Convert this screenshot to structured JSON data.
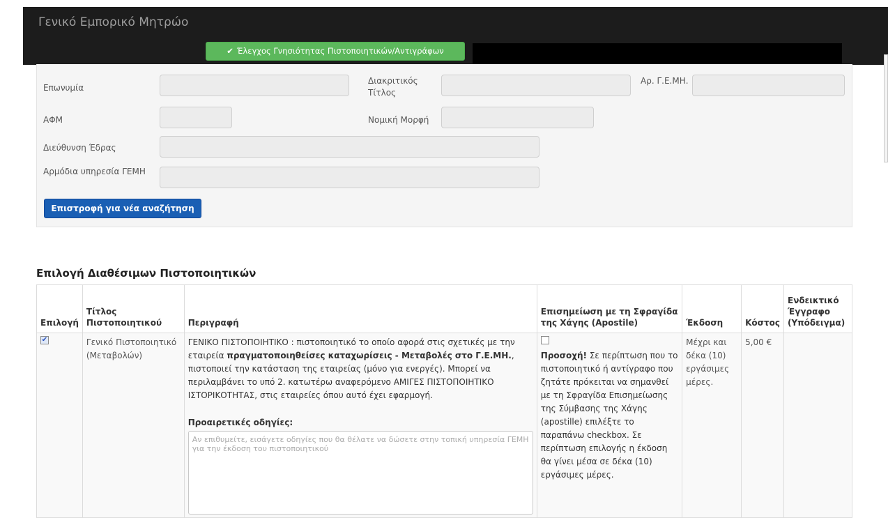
{
  "header": {
    "brand": "Γενικό Εμπορικό Μητρώο",
    "verify_button": "Έλεγχος Γνησιότητας Πιστοποιητικών/Αντιγράφων",
    "check_icon": "check-square-icon"
  },
  "company": {
    "name_label": "Επωνυμία",
    "title_label": "Διακριτικός Τίτλος",
    "gemi_label": "Αρ. Γ.Ε.ΜΗ.",
    "afm_label": "ΑΦΜ",
    "legal_form_label": "Νομική Μορφή",
    "address_label": "Διεύθυνση Έδρας",
    "service_label": "Αρμόδια υπηρεσία ΓΕΜΗ",
    "back_button": "Επιστροφή για νέα αναζήτηση"
  },
  "certificates": {
    "title": "Επιλογή Διαθέσιμων Πιστοποιητικών",
    "columns": {
      "select": "Επιλογή",
      "title": "Τίτλος Πιστοποιητικού",
      "description": "Περιγραφή",
      "apostille": "Επισημείωση με τη Σφραγίδα της Χάγης (Apostile)",
      "issue": "Έκδοση",
      "cost": "Κόστος",
      "sample": "Ενδεικτικό Έγγραφο (Υπόδειγμα)"
    },
    "rows": [
      {
        "selected": true,
        "title": "Γενικό Πιστοποιητικό (Μεταβολών)",
        "desc_part1": "ΓΕΝΙΚΟ ΠΙΣΤΟΠΟΙΗΤΙΚΟ : πιστοποιητικό το οποίο αφορά στις σχετικές με την εταιρεία ",
        "desc_bold": "πραγματοποιηθείσες καταχωρίσεις - Μεταβολές στο Γ.Ε.ΜΗ.",
        "desc_part2": ", πιστοποιεί την κατάσταση της εταιρείας (μόνο για ενεργές). Μπορεί να περιλαμβάνει το υπό 2. κατωτέρω αναφερόμενο ΑΜΙΓΕΣ ΠΙΣΤΟΠΟΙΗΤΙΚΟ ΙΣΤΟΡΙΚΟΤΗΤΑΣ, στις εταιρείες όπου αυτό έχει εφαρμογή.",
        "optional_label": "Προαιρετικές οδηγίες:",
        "notes_placeholder": "Αν επιθυμείτε, εισάγετε οδηγίες που θα θέλατε να δώσετε στην τοπική υπηρεσία ΓΕΜΗ για την έκδοση του πιστοποιητικού",
        "apostille_checked": false,
        "apostille_warn": "Προσοχή!",
        "apostille_text": " Σε περίπτωση που το πιστοποιητικό ή αντίγραφο που ζητάτε πρόκειται να σημανθεί με τη Σφραγίδα Επισημείωσης της Σύμβασης της Χάγης (apostille) επιλέξτε το παραπάνω checkbox. Σε περίπτωση επιλογής η έκδοση θα γίνει μέσα σε δέκα (10) εργάσιμες μέρες.",
        "issue": "Μέχρι και δέκα (10) εργάσιμες μέρες.",
        "cost": "5,00 €"
      }
    ]
  }
}
